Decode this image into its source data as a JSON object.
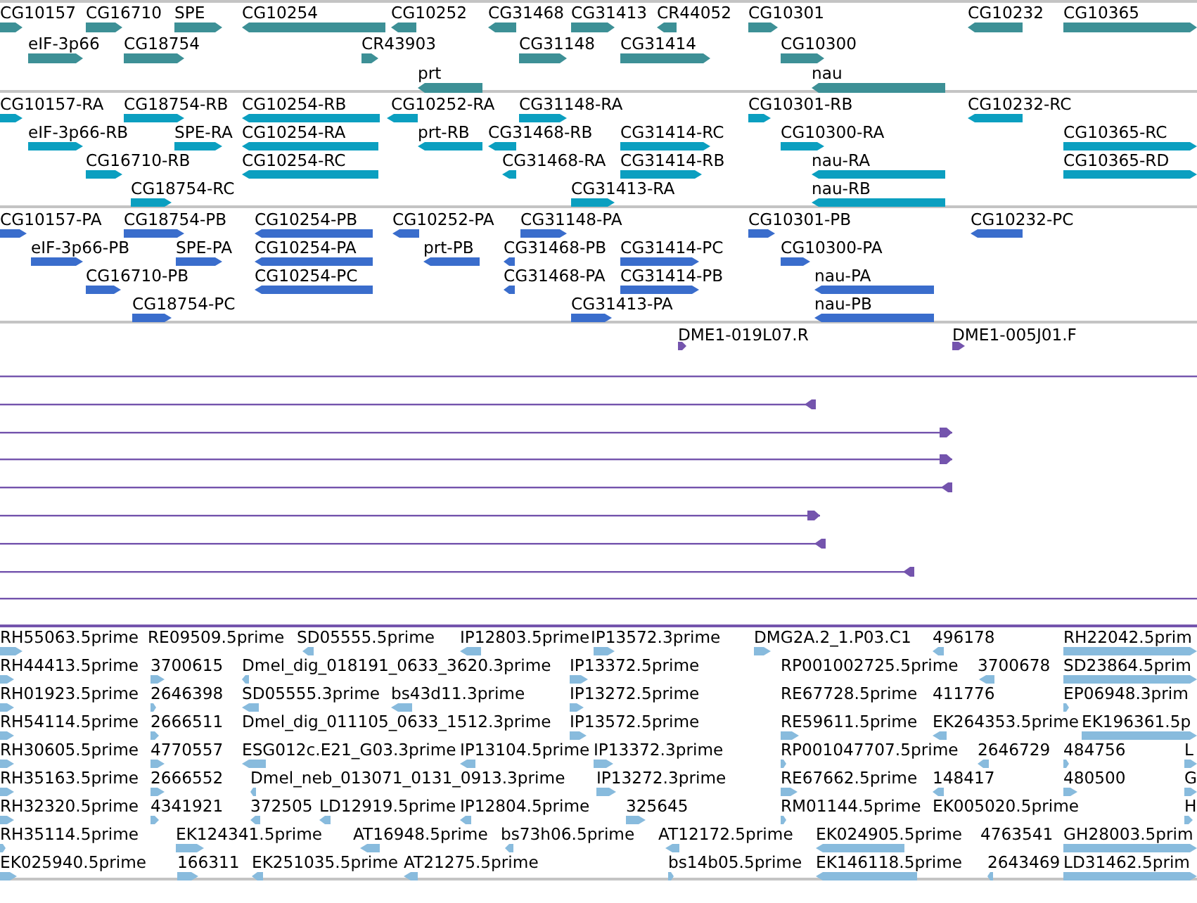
{
  "tracks": [
    {
      "kind": "gene",
      "color": "#3d9096",
      "features": [
        {
          "label": "CG10157",
          "reverse": false
        },
        {
          "label": "CG16710",
          "reverse": false
        },
        {
          "label": "SPE",
          "reverse": false
        },
        {
          "label": "CG10254",
          "reverse": true
        },
        {
          "label": "CG10252",
          "reverse": true
        },
        {
          "label": "CG31468",
          "reverse": true
        },
        {
          "label": "CG31413",
          "reverse": false
        },
        {
          "label": "CR44052",
          "reverse": true
        },
        {
          "label": "CG10301",
          "reverse": false
        },
        {
          "label": "CG10232",
          "reverse": true
        },
        {
          "label": "CG10365",
          "reverse": false
        },
        {
          "label": "eIF-3p66",
          "reverse": false
        },
        {
          "label": "CG18754",
          "reverse": false
        },
        {
          "label": "CR43903",
          "reverse": false
        },
        {
          "label": "CG31148",
          "reverse": false
        },
        {
          "label": "CG31414",
          "reverse": false
        },
        {
          "label": "CG10300",
          "reverse": false
        },
        {
          "label": "prt",
          "reverse": true
        },
        {
          "label": "nau",
          "reverse": true
        }
      ]
    },
    {
      "kind": "transcript",
      "color": "#0b9fc0",
      "features": [
        {
          "label": "CG10157-RA",
          "reverse": false
        },
        {
          "label": "CG18754-RB",
          "reverse": false
        },
        {
          "label": "CG10254-RB",
          "reverse": true
        },
        {
          "label": "CG10252-RA",
          "reverse": true
        },
        {
          "label": "CG31148-RA",
          "reverse": false
        },
        {
          "label": "CG10301-RB",
          "reverse": false
        },
        {
          "label": "CG10232-RC",
          "reverse": true
        },
        {
          "label": "eIF-3p66-RB",
          "reverse": false
        },
        {
          "label": "SPE-RA",
          "reverse": false
        },
        {
          "label": "CG10254-RA",
          "reverse": true
        },
        {
          "label": "prt-RB",
          "reverse": true
        },
        {
          "label": "CG31468-RB",
          "reverse": true
        },
        {
          "label": "CG31414-RC",
          "reverse": false
        },
        {
          "label": "CG10300-RA",
          "reverse": false
        },
        {
          "label": "CG10365-RC",
          "reverse": false
        },
        {
          "label": "CG16710-RB",
          "reverse": false
        },
        {
          "label": "CG10254-RC",
          "reverse": true
        },
        {
          "label": "CG31468-RA",
          "reverse": true
        },
        {
          "label": "CG31414-RB",
          "reverse": false
        },
        {
          "label": "nau-RA",
          "reverse": true
        },
        {
          "label": "CG10365-RD",
          "reverse": false
        },
        {
          "label": "CG18754-RC",
          "reverse": false
        },
        {
          "label": "CG31413-RA",
          "reverse": false
        },
        {
          "label": "nau-RB",
          "reverse": true
        }
      ]
    },
    {
      "kind": "protein",
      "color": "#3a6dcc",
      "features": [
        {
          "label": "CG10157-PA",
          "reverse": false
        },
        {
          "label": "CG18754-PB",
          "reverse": false
        },
        {
          "label": "CG10254-PB",
          "reverse": true
        },
        {
          "label": "CG10252-PA",
          "reverse": true
        },
        {
          "label": "CG31148-PA",
          "reverse": false
        },
        {
          "label": "CG10301-PB",
          "reverse": false
        },
        {
          "label": "CG10232-PC",
          "reverse": true
        },
        {
          "label": "eIF-3p66-PB",
          "reverse": false
        },
        {
          "label": "SPE-PA",
          "reverse": false
        },
        {
          "label": "CG10254-PA",
          "reverse": true
        },
        {
          "label": "prt-PB",
          "reverse": true
        },
        {
          "label": "CG31468-PB",
          "reverse": true
        },
        {
          "label": "CG31414-PC",
          "reverse": false
        },
        {
          "label": "CG10300-PA",
          "reverse": false
        },
        {
          "label": "CG16710-PB",
          "reverse": false
        },
        {
          "label": "CG10254-PC",
          "reverse": true
        },
        {
          "label": "CG31468-PA",
          "reverse": true
        },
        {
          "label": "CG31414-PB",
          "reverse": false
        },
        {
          "label": "nau-PA",
          "reverse": true
        },
        {
          "label": "CG18754-PC",
          "reverse": false
        },
        {
          "label": "CG31413-PA",
          "reverse": false
        },
        {
          "label": "nau-PB",
          "reverse": true
        }
      ]
    },
    {
      "kind": "clone",
      "color": "#7454ad",
      "features": [
        {
          "label": "DME1-019L07.R",
          "reverse": false
        },
        {
          "label": "DME1-005J01.F",
          "reverse": false
        }
      ],
      "lines": [
        {
          "kind": "plain"
        },
        {
          "kind": "reverse"
        },
        {
          "kind": "forward"
        },
        {
          "kind": "forward"
        },
        {
          "kind": "reverse"
        },
        {
          "kind": "forward"
        },
        {
          "kind": "reverse"
        },
        {
          "kind": "reverse"
        },
        {
          "kind": "plain"
        }
      ]
    },
    {
      "kind": "est",
      "color": "#88bbdd",
      "features": [
        {
          "label": "RH55063.5prime",
          "reverse": false
        },
        {
          "label": "RE09509.5prime"
        },
        {
          "label": "SD05555.5prime",
          "reverse": true
        },
        {
          "label": "IP12803.5prime",
          "reverse": true
        },
        {
          "label": "IP13572.3prime",
          "reverse": false
        },
        {
          "label": "DMG2A.2_1.P03.C1",
          "reverse": false
        },
        {
          "label": "496178",
          "reverse": true
        },
        {
          "label": "RH22042.5prim",
          "reverse": false
        },
        {
          "label": "RH44413.5prime",
          "reverse": false
        },
        {
          "label": "3700615",
          "reverse": false
        },
        {
          "label": "Dmel_dig_018191_0633_3620.3prime",
          "reverse": true
        },
        {
          "label": "IP13372.5prime",
          "reverse": false
        },
        {
          "label": "RP001002725.5prime"
        },
        {
          "label": "3700678",
          "reverse": true
        },
        {
          "label": "SD23864.5prim",
          "reverse": false
        },
        {
          "label": "RH01923.5prime",
          "reverse": false
        },
        {
          "label": "2646398",
          "reverse": false
        },
        {
          "label": "SD05555.3prime",
          "reverse": true
        },
        {
          "label": "bs43d11.3prime",
          "reverse": true
        },
        {
          "label": "IP13272.5prime",
          "reverse": false
        },
        {
          "label": "RE67728.5prime"
        },
        {
          "label": "411776"
        },
        {
          "label": "EP06948.3prim",
          "reverse": false
        },
        {
          "label": "RH54114.5prime",
          "reverse": false
        },
        {
          "label": "2666511",
          "reverse": false
        },
        {
          "label": "Dmel_dig_011105_0633_1512.3prime"
        },
        {
          "label": "IP13572.5prime",
          "reverse": false
        },
        {
          "label": "RE59611.5prime",
          "reverse": false
        },
        {
          "label": "EK264353.5prime",
          "reverse": true
        },
        {
          "label": "EK196361.5p",
          "reverse": false
        },
        {
          "label": "RH30605.5prime",
          "reverse": false
        },
        {
          "label": "4770557",
          "reverse": false
        },
        {
          "label": "ESG012c.E21_G03.3prime",
          "reverse": true
        },
        {
          "label": "IP13104.5prime",
          "reverse": true
        },
        {
          "label": "IP13372.3prime",
          "reverse": false
        },
        {
          "label": "RP001047707.5prime",
          "reverse": false
        },
        {
          "label": "2646729",
          "reverse": true
        },
        {
          "label": "484756",
          "reverse": false
        },
        {
          "label": "L",
          "reverse": false
        },
        {
          "label": "RH35163.5prime",
          "reverse": false
        },
        {
          "label": "2666552",
          "reverse": false
        },
        {
          "label": "Dmel_neb_013071_0131_0913.3prime",
          "reverse": true
        },
        {
          "label": "IP13272.3prime",
          "reverse": false
        },
        {
          "label": "RE67662.5prime",
          "reverse": false
        },
        {
          "label": "148417",
          "reverse": true
        },
        {
          "label": "480500",
          "reverse": false
        },
        {
          "label": "G",
          "reverse": false
        },
        {
          "label": "RH32320.5prime",
          "reverse": false
        },
        {
          "label": "4341921",
          "reverse": false
        },
        {
          "label": "372505",
          "reverse": true
        },
        {
          "label": "LD12919.5prime",
          "reverse": true
        },
        {
          "label": "IP12804.5prime",
          "reverse": true
        },
        {
          "label": "325645",
          "reverse": false
        },
        {
          "label": "RM01144.5prime",
          "reverse": false
        },
        {
          "label": "EK005020.5prime"
        },
        {
          "label": "H",
          "reverse": false
        },
        {
          "label": "RH35114.5prime",
          "reverse": false
        },
        {
          "label": "EK124341.5prime",
          "reverse": false
        },
        {
          "label": "AT16948.5prime",
          "reverse": true
        },
        {
          "label": "bs73h06.5prime",
          "reverse": true
        },
        {
          "label": "AT12172.5prime",
          "reverse": true
        },
        {
          "label": "EK024905.5prime",
          "reverse": true
        },
        {
          "label": "4763541"
        },
        {
          "label": "GH28003.5prim",
          "reverse": false
        },
        {
          "label": "EK025940.5prime",
          "reverse": false
        },
        {
          "label": "166311",
          "reverse": false
        },
        {
          "label": "EK251035.5prime",
          "reverse": true
        },
        {
          "label": "AT21275.5prime",
          "reverse": true
        },
        {
          "label": "bs14b05.5prime",
          "reverse": false
        },
        {
          "label": "EK146118.5prime",
          "reverse": true
        },
        {
          "label": "2643469",
          "reverse": true
        },
        {
          "label": "LD31462.5prim",
          "reverse": false
        }
      ]
    }
  ]
}
